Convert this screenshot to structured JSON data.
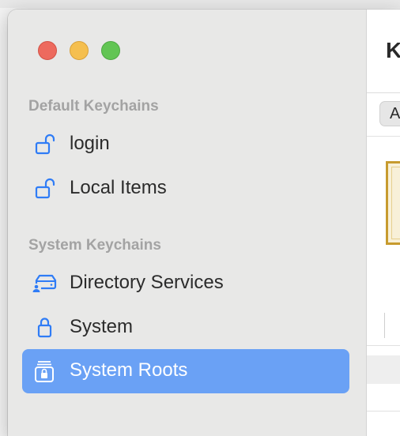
{
  "sidebar": {
    "sections": [
      {
        "title": "Default Keychains",
        "items": [
          {
            "label": "login",
            "icon": "unlocked-lock-icon"
          },
          {
            "label": "Local Items",
            "icon": "unlocked-lock-icon"
          }
        ]
      },
      {
        "title": "System Keychains",
        "items": [
          {
            "label": "Directory Services",
            "icon": "directory-server-icon"
          },
          {
            "label": "System",
            "icon": "lock-icon"
          },
          {
            "label": "System Roots",
            "icon": "stacked-lock-icon",
            "selected": true
          }
        ]
      }
    ]
  },
  "content": {
    "title_partial": "K",
    "segment_partial": "A"
  },
  "colors": {
    "sidebar_bg": "#e8e8e7",
    "selection": "#6aa1f5",
    "icon_blue": "#2f7cf6",
    "section_title": "#a3a3a3"
  }
}
